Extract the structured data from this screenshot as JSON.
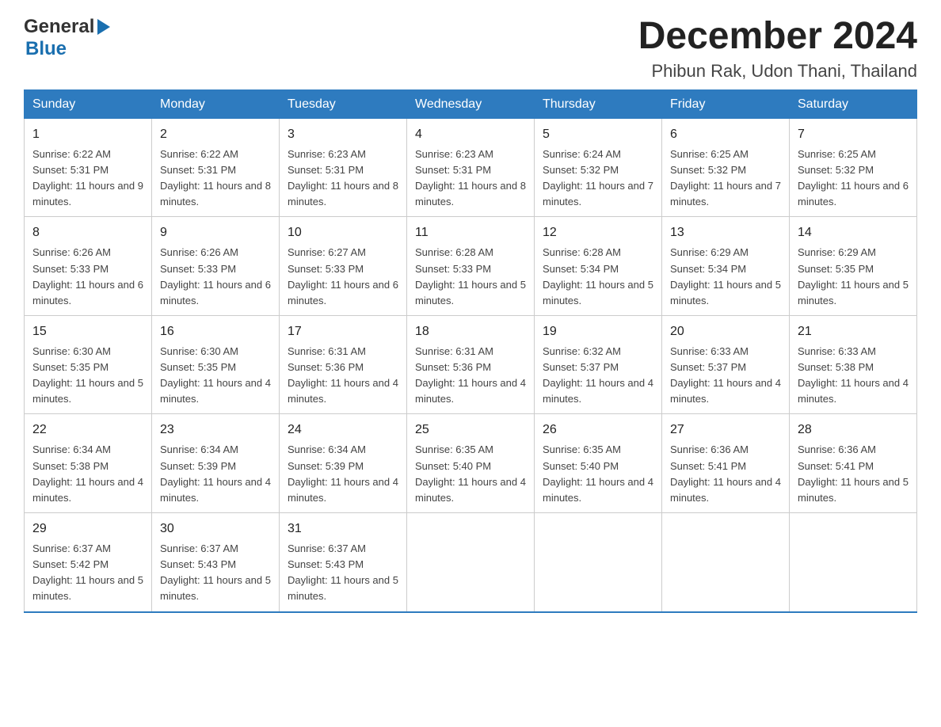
{
  "header": {
    "logo_general": "General",
    "logo_blue": "Blue",
    "month_title": "December 2024",
    "subtitle": "Phibun Rak, Udon Thani, Thailand"
  },
  "days_of_week": [
    "Sunday",
    "Monday",
    "Tuesday",
    "Wednesday",
    "Thursday",
    "Friday",
    "Saturday"
  ],
  "weeks": [
    [
      {
        "date": "1",
        "sunrise": "6:22 AM",
        "sunset": "5:31 PM",
        "daylight": "11 hours and 9 minutes."
      },
      {
        "date": "2",
        "sunrise": "6:22 AM",
        "sunset": "5:31 PM",
        "daylight": "11 hours and 8 minutes."
      },
      {
        "date": "3",
        "sunrise": "6:23 AM",
        "sunset": "5:31 PM",
        "daylight": "11 hours and 8 minutes."
      },
      {
        "date": "4",
        "sunrise": "6:23 AM",
        "sunset": "5:31 PM",
        "daylight": "11 hours and 8 minutes."
      },
      {
        "date": "5",
        "sunrise": "6:24 AM",
        "sunset": "5:32 PM",
        "daylight": "11 hours and 7 minutes."
      },
      {
        "date": "6",
        "sunrise": "6:25 AM",
        "sunset": "5:32 PM",
        "daylight": "11 hours and 7 minutes."
      },
      {
        "date": "7",
        "sunrise": "6:25 AM",
        "sunset": "5:32 PM",
        "daylight": "11 hours and 6 minutes."
      }
    ],
    [
      {
        "date": "8",
        "sunrise": "6:26 AM",
        "sunset": "5:33 PM",
        "daylight": "11 hours and 6 minutes."
      },
      {
        "date": "9",
        "sunrise": "6:26 AM",
        "sunset": "5:33 PM",
        "daylight": "11 hours and 6 minutes."
      },
      {
        "date": "10",
        "sunrise": "6:27 AM",
        "sunset": "5:33 PM",
        "daylight": "11 hours and 6 minutes."
      },
      {
        "date": "11",
        "sunrise": "6:28 AM",
        "sunset": "5:33 PM",
        "daylight": "11 hours and 5 minutes."
      },
      {
        "date": "12",
        "sunrise": "6:28 AM",
        "sunset": "5:34 PM",
        "daylight": "11 hours and 5 minutes."
      },
      {
        "date": "13",
        "sunrise": "6:29 AM",
        "sunset": "5:34 PM",
        "daylight": "11 hours and 5 minutes."
      },
      {
        "date": "14",
        "sunrise": "6:29 AM",
        "sunset": "5:35 PM",
        "daylight": "11 hours and 5 minutes."
      }
    ],
    [
      {
        "date": "15",
        "sunrise": "6:30 AM",
        "sunset": "5:35 PM",
        "daylight": "11 hours and 5 minutes."
      },
      {
        "date": "16",
        "sunrise": "6:30 AM",
        "sunset": "5:35 PM",
        "daylight": "11 hours and 4 minutes."
      },
      {
        "date": "17",
        "sunrise": "6:31 AM",
        "sunset": "5:36 PM",
        "daylight": "11 hours and 4 minutes."
      },
      {
        "date": "18",
        "sunrise": "6:31 AM",
        "sunset": "5:36 PM",
        "daylight": "11 hours and 4 minutes."
      },
      {
        "date": "19",
        "sunrise": "6:32 AM",
        "sunset": "5:37 PM",
        "daylight": "11 hours and 4 minutes."
      },
      {
        "date": "20",
        "sunrise": "6:33 AM",
        "sunset": "5:37 PM",
        "daylight": "11 hours and 4 minutes."
      },
      {
        "date": "21",
        "sunrise": "6:33 AM",
        "sunset": "5:38 PM",
        "daylight": "11 hours and 4 minutes."
      }
    ],
    [
      {
        "date": "22",
        "sunrise": "6:34 AM",
        "sunset": "5:38 PM",
        "daylight": "11 hours and 4 minutes."
      },
      {
        "date": "23",
        "sunrise": "6:34 AM",
        "sunset": "5:39 PM",
        "daylight": "11 hours and 4 minutes."
      },
      {
        "date": "24",
        "sunrise": "6:34 AM",
        "sunset": "5:39 PM",
        "daylight": "11 hours and 4 minutes."
      },
      {
        "date": "25",
        "sunrise": "6:35 AM",
        "sunset": "5:40 PM",
        "daylight": "11 hours and 4 minutes."
      },
      {
        "date": "26",
        "sunrise": "6:35 AM",
        "sunset": "5:40 PM",
        "daylight": "11 hours and 4 minutes."
      },
      {
        "date": "27",
        "sunrise": "6:36 AM",
        "sunset": "5:41 PM",
        "daylight": "11 hours and 4 minutes."
      },
      {
        "date": "28",
        "sunrise": "6:36 AM",
        "sunset": "5:41 PM",
        "daylight": "11 hours and 5 minutes."
      }
    ],
    [
      {
        "date": "29",
        "sunrise": "6:37 AM",
        "sunset": "5:42 PM",
        "daylight": "11 hours and 5 minutes."
      },
      {
        "date": "30",
        "sunrise": "6:37 AM",
        "sunset": "5:43 PM",
        "daylight": "11 hours and 5 minutes."
      },
      {
        "date": "31",
        "sunrise": "6:37 AM",
        "sunset": "5:43 PM",
        "daylight": "11 hours and 5 minutes."
      },
      null,
      null,
      null,
      null
    ]
  ],
  "labels": {
    "sunrise_prefix": "Sunrise: ",
    "sunset_prefix": "Sunset: ",
    "daylight_prefix": "Daylight: "
  }
}
